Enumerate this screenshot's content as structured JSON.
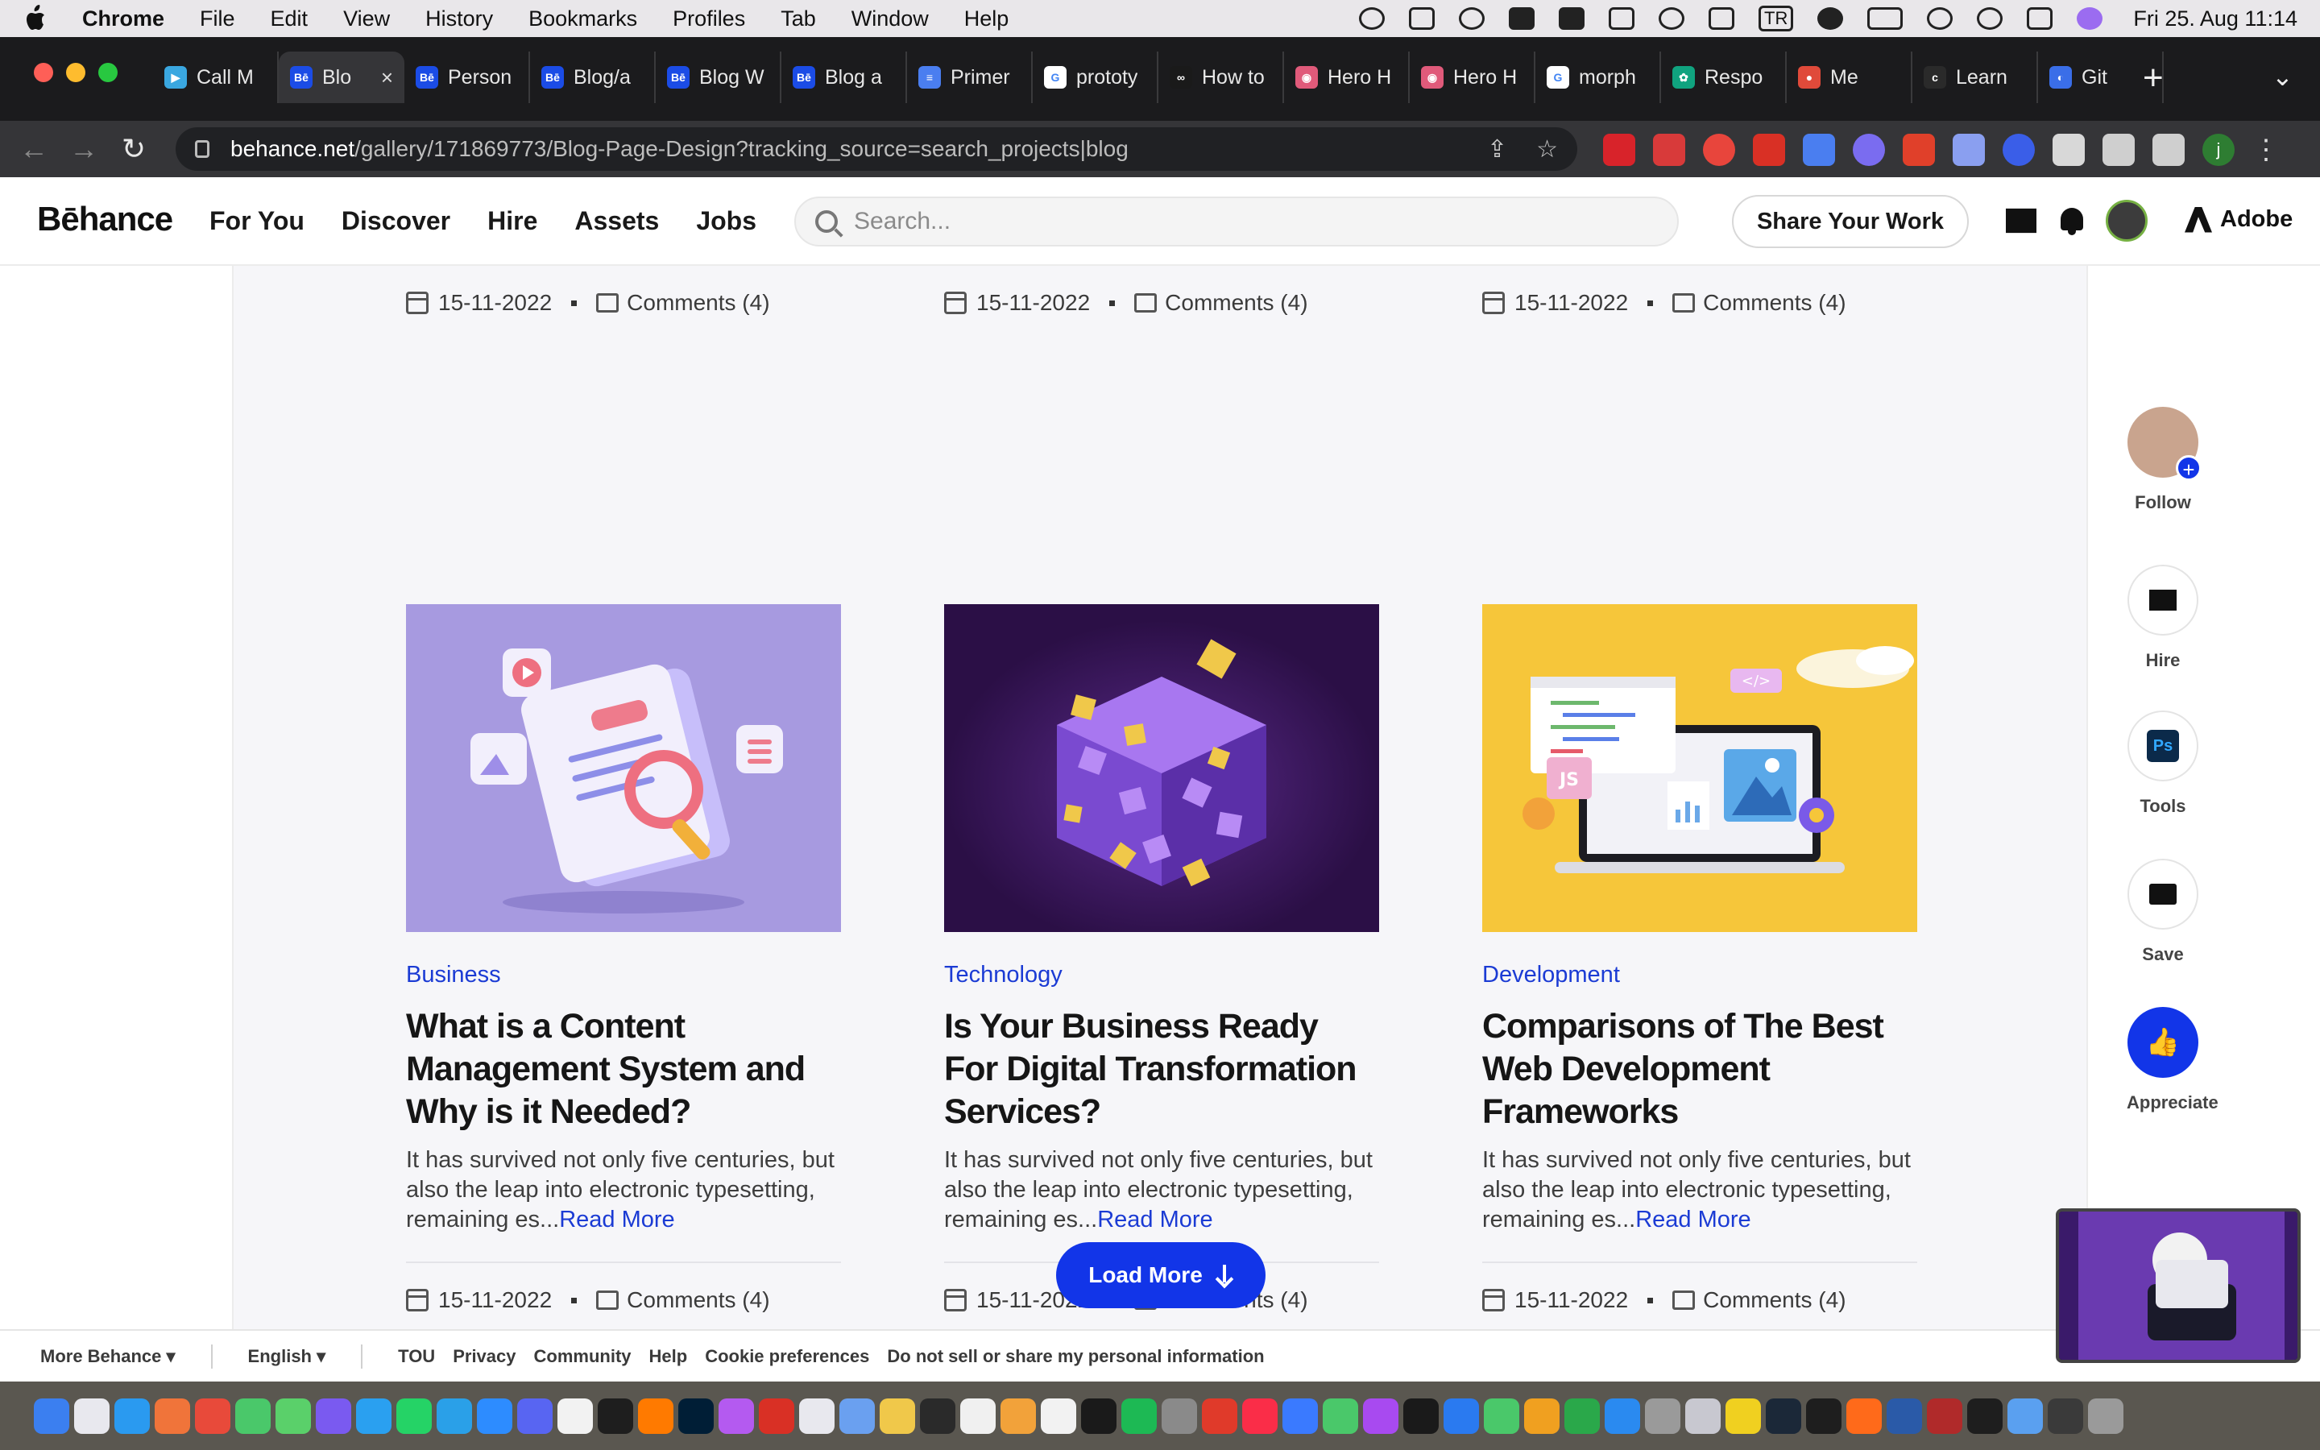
{
  "menubar": {
    "app": "Chrome",
    "items": [
      "File",
      "Edit",
      "View",
      "History",
      "Bookmarks",
      "Profiles",
      "Tab",
      "Window",
      "Help"
    ],
    "clock": "Fri 25. Aug  11:14",
    "input_source": "TR"
  },
  "tabs": [
    {
      "label": "Call M",
      "fav": "▶",
      "color": "#3aa7e0"
    },
    {
      "label": "Blo",
      "fav": "Bē",
      "color": "#1b4ce6",
      "active": true
    },
    {
      "label": "Person",
      "fav": "Bē",
      "color": "#1b4ce6"
    },
    {
      "label": "Blog/a",
      "fav": "Bē",
      "color": "#1b4ce6"
    },
    {
      "label": "Blog W",
      "fav": "Bē",
      "color": "#1b4ce6"
    },
    {
      "label": "Blog a",
      "fav": "Bē",
      "color": "#1b4ce6"
    },
    {
      "label": "Primer",
      "fav": "≡",
      "color": "#4a7ef0"
    },
    {
      "label": "prototy",
      "fav": "G",
      "color": "#ffffff"
    },
    {
      "label": "How to",
      "fav": "∞",
      "color": "#1a1a1a"
    },
    {
      "label": "Hero H",
      "fav": "◉",
      "color": "#e05a7a"
    },
    {
      "label": "Hero H",
      "fav": "◉",
      "color": "#e05a7a"
    },
    {
      "label": "morph",
      "fav": "G",
      "color": "#ffffff"
    },
    {
      "label": "Respo",
      "fav": "✿",
      "color": "#10a37f"
    },
    {
      "label": "Me",
      "fav": "●",
      "color": "#e04a3a"
    },
    {
      "label": "Learn",
      "fav": "c",
      "color": "#2a2a2a"
    },
    {
      "label": "Git",
      "fav": "◐",
      "color": "#3a6ee8"
    }
  ],
  "toolbar": {
    "url_host": "behance.net",
    "url_path": "/gallery/171869773/Blog-Page-Design?tracking_source=search_projects|blog",
    "profile_initial": "j"
  },
  "behance": {
    "logo": "Bēhance",
    "nav": [
      "For You",
      "Discover",
      "Hire",
      "Assets",
      "Jobs"
    ],
    "search_placeholder": "Search...",
    "share_label": "Share Your Work",
    "adobe_label": "Adobe"
  },
  "top_meta": [
    {
      "date": "15-11-2022",
      "comments": "Comments (4)"
    },
    {
      "date": "15-11-2022",
      "comments": "Comments (4)"
    },
    {
      "date": "15-11-2022",
      "comments": "Comments (4)"
    }
  ],
  "cards": [
    {
      "category": "Business",
      "title": "What is a Content Management System and Why is it Needed?",
      "excerpt": "It has survived not only five centuries, but also the leap into electronic typesetting, remaining es...",
      "read_more": "Read More",
      "date": "15-11-2022",
      "comments": "Comments (4)"
    },
    {
      "category": "Technology",
      "title": "Is Your Business Ready For Digital Transformation Services?",
      "excerpt": "It has survived not only five centuries, but also the leap into electronic typesetting, remaining es...",
      "read_more": "Read More",
      "date": "15-11-2022",
      "comments": "Comments (4)"
    },
    {
      "category": "Development",
      "title": "Comparisons of The Best Web Development Frameworks",
      "excerpt": "It has survived not only five centuries, but also the leap into electronic typesetting, remaining es...",
      "read_more": "Read More",
      "date": "15-11-2022",
      "comments": "Comments (4)"
    }
  ],
  "load_more": "Load More",
  "sidebar": {
    "follow": "Follow",
    "hire": "Hire",
    "tools": "Tools",
    "tools_badge": "Ps",
    "save": "Save",
    "appreciate": "Appreciate"
  },
  "footer": {
    "more": "More Behance ▾",
    "language": "English ▾",
    "links": [
      "TOU",
      "Privacy",
      "Community",
      "Help",
      "Cookie preferences",
      "Do not sell or share my personal information"
    ]
  },
  "colors": {
    "accent": "#1235e8",
    "link": "#1b3bd4",
    "card1_bg": "#a79ae0",
    "card2_bg": "#2b0f46",
    "card3_bg": "#f6c63a"
  }
}
